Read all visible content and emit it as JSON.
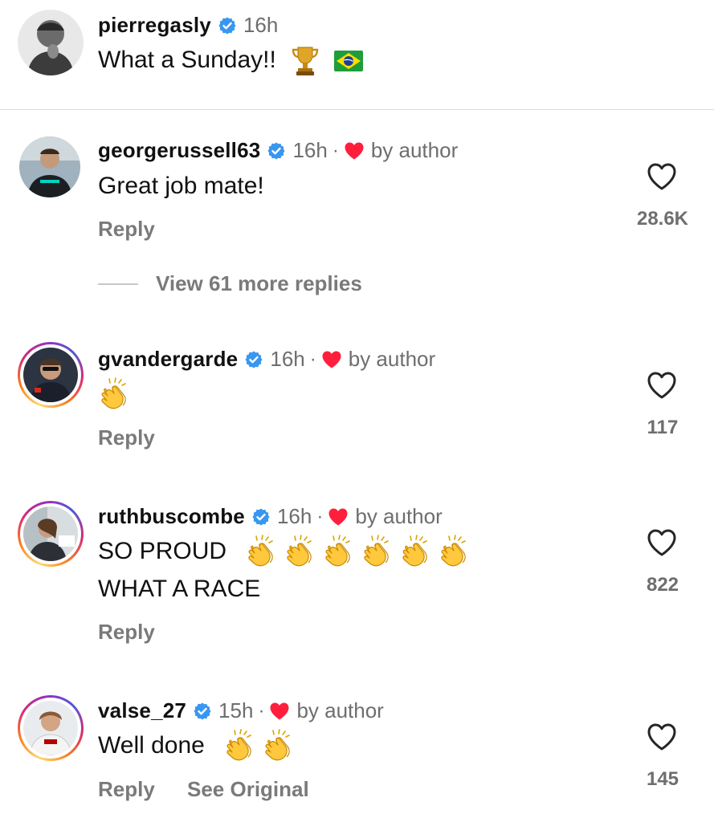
{
  "post": {
    "username": "pierregasly",
    "time": "16h",
    "caption": "What a Sunday!!",
    "caption_emoji": [
      "trophy",
      "brazil-flag"
    ]
  },
  "comments": [
    {
      "username": "georgerussell63",
      "time": "16h",
      "separator": "·",
      "liked_label": "by author",
      "text": "Great job mate!",
      "reply_label": "Reply",
      "likes": "28.6K"
    },
    {
      "username": "gvandergarde",
      "time": "16h",
      "separator": "·",
      "liked_label": "by author",
      "text": "",
      "emoji": [
        "clapping-hands"
      ],
      "reply_label": "Reply",
      "likes": "117"
    },
    {
      "username": "ruthbuscombe",
      "time": "16h",
      "separator": "·",
      "liked_label": "by author",
      "text_line1": "SO PROUD",
      "text_line2": "WHAT A RACE",
      "emoji": [
        "clapping-hands",
        "clapping-hands",
        "clapping-hands",
        "clapping-hands",
        "clapping-hands",
        "clapping-hands"
      ],
      "reply_label": "Reply",
      "likes": "822"
    },
    {
      "username": "valse_27",
      "time": "15h",
      "separator": "·",
      "liked_label": "by author",
      "text": "Well done",
      "emoji": [
        "clapping-hands",
        "clapping-hands"
      ],
      "reply_label": "Reply",
      "see_original_label": "See Original",
      "likes": "145"
    }
  ],
  "view_more_replies": "View 61 more replies",
  "colors": {
    "verified": "#3897f0",
    "heart_red": "#ff3040",
    "muted": "#6e6e6e"
  }
}
